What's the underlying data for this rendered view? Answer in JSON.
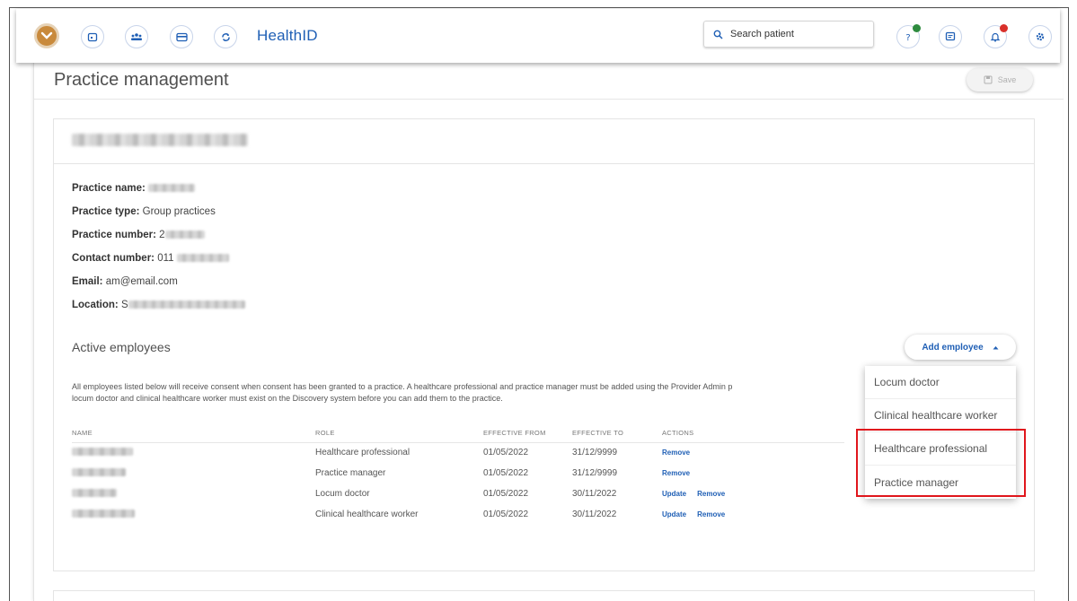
{
  "topbar": {
    "brand": "HealthID",
    "search_placeholder": "Search patient",
    "nav_icons": [
      "calendar-icon",
      "group-icon",
      "card-icon",
      "sync-icon"
    ],
    "right_icons": [
      "help-icon",
      "chat-icon",
      "bell-icon",
      "settings-icon"
    ],
    "colors": {
      "brand": "#1f5fb5",
      "help_dot": "#2e8b3e",
      "bell_dot": "#d9302a"
    }
  },
  "page": {
    "title": "Practice management",
    "save_label": "Save"
  },
  "practice": {
    "name_label": "Practice name:",
    "type_label": "Practice type:",
    "type_value": "Group practices",
    "number_label": "Practice number:",
    "number_value": "2",
    "contact_label": "Contact number:",
    "contact_value": "011",
    "email_label": "Email:",
    "email_value": "am@email.com",
    "location_label": "Location:",
    "location_value": "S"
  },
  "employees": {
    "title": "Active employees",
    "add_label": "Add employee",
    "notice_line1": "All employees listed below will receive consent when consent has been granted to a practice. A healthcare professional and practice manager must be added using the Provider Admin p",
    "notice_line2": "locum doctor and clinical healthcare worker must exist on the Discovery system before you can add them to the practice.",
    "columns": [
      "NAME",
      "ROLE",
      "EFFECTIVE FROM",
      "EFFECTIVE TO",
      "ACTIONS"
    ],
    "rows": [
      {
        "role": "Healthcare professional",
        "from": "01/05/2022",
        "to": "31/12/9999",
        "update": "",
        "remove": "Remove"
      },
      {
        "role": "Practice manager",
        "from": "01/05/2022",
        "to": "31/12/9999",
        "update": "",
        "remove": "Remove"
      },
      {
        "role": "Locum doctor",
        "from": "01/05/2022",
        "to": "30/11/2022",
        "update": "Update",
        "remove": "Remove"
      },
      {
        "role": "Clinical healthcare worker",
        "from": "01/05/2022",
        "to": "30/11/2022",
        "update": "Update",
        "remove": "Remove"
      }
    ]
  },
  "menu": {
    "items": [
      "Locum doctor",
      "Clinical healthcare worker",
      "Healthcare professional",
      "Practice manager"
    ],
    "highlight_color": "#e0161c"
  }
}
